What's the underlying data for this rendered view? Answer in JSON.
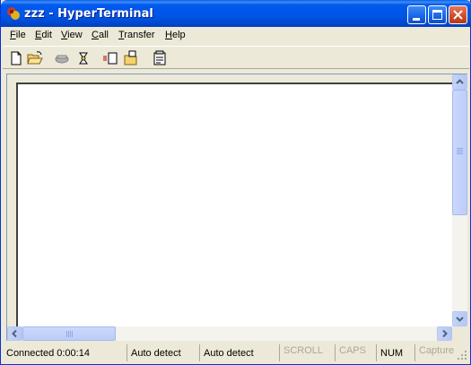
{
  "window": {
    "title": "zzz - HyperTerminal",
    "controls": {
      "minimize": "minimize",
      "maximize": "maximize",
      "close": "close"
    }
  },
  "menubar": {
    "items": [
      {
        "label_u": "F",
        "label_rest": "ile"
      },
      {
        "label_u": "E",
        "label_rest": "dit"
      },
      {
        "label_u": "V",
        "label_rest": "iew"
      },
      {
        "label_u": "C",
        "label_rest": "all"
      },
      {
        "label_u": "T",
        "label_rest": "ransfer"
      },
      {
        "label_u": "H",
        "label_rest": "elp"
      }
    ]
  },
  "toolbar": {
    "icons": [
      "new-connection-icon",
      "open-icon",
      "call-icon",
      "disconnect-icon",
      "send-file-icon",
      "receive-file-icon",
      "properties-icon"
    ]
  },
  "statusbar": {
    "connected": "Connected 0:00:14",
    "detect1": "Auto detect",
    "detect2": "Auto detect",
    "scroll": "SCROLL",
    "caps": "CAPS",
    "num": "NUM",
    "capture": "Capture"
  }
}
